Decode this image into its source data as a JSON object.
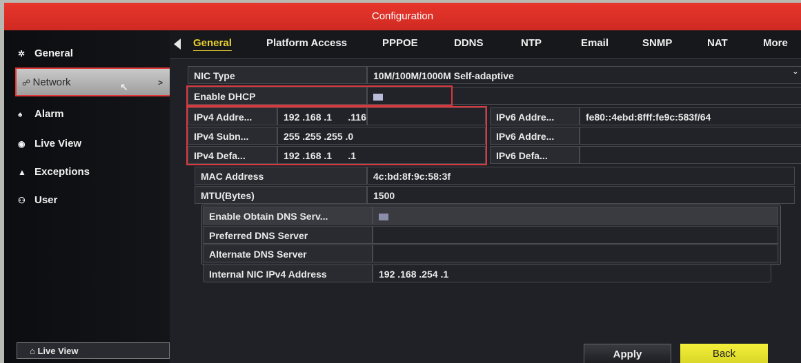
{
  "window": {
    "title": "Configuration"
  },
  "sidebar": {
    "items": [
      {
        "label": "General",
        "icon": "gear-icon"
      },
      {
        "label": "Network",
        "icon": "network-icon"
      },
      {
        "label": "Alarm",
        "icon": "alarm-icon"
      },
      {
        "label": "Live View",
        "icon": "eye-icon"
      },
      {
        "label": "Exceptions",
        "icon": "warning-icon"
      },
      {
        "label": "User",
        "icon": "users-icon"
      }
    ],
    "network_arrow": ">",
    "live_view_button": "Live View"
  },
  "tabs": [
    "General",
    "Platform Access",
    "PPPOE",
    "DDNS",
    "NTP",
    "Email",
    "SNMP",
    "NAT",
    "More"
  ],
  "form": {
    "nic_type_label": "NIC Type",
    "nic_type_value": "10M/100M/1000M Self-adaptive",
    "enable_dhcp_label": "Enable DHCP",
    "ipv4_address_label": "IPv4 Addre...",
    "ipv4_address_value": "192 .168 .1      .116",
    "ipv4_subnet_label": "IPv4 Subn...",
    "ipv4_subnet_value": "255 .255 .255 .0",
    "ipv4_gateway_label": "IPv4 Defa...",
    "ipv4_gateway_value": "192 .168 .1      .1",
    "ipv6_address_label": "IPv6 Addre...",
    "ipv6_address_value": "fe80::4ebd:8fff:fe9c:583f/64",
    "ipv6_address2_label": "IPv6 Addre...",
    "ipv6_gateway_label": "IPv6 Defa...",
    "mac_label": "MAC Address",
    "mac_value": "4c:bd:8f:9c:58:3f",
    "mtu_label": "MTU(Bytes)",
    "mtu_value": "1500",
    "dns_auto_label": "Enable Obtain DNS Serv...",
    "preferred_dns_label": "Preferred DNS Server",
    "alternate_dns_label": "Alternate DNS Server",
    "internal_nic_label": "Internal NIC IPv4 Address",
    "internal_nic_value": "192 .168 .254 .1"
  },
  "buttons": {
    "apply": "Apply",
    "back": "Back"
  },
  "colors": {
    "title_bar": "#d8302a",
    "active_tab": "#e8cf2e",
    "highlight_box": "#d8383e",
    "back_button": "#e6e22f"
  }
}
